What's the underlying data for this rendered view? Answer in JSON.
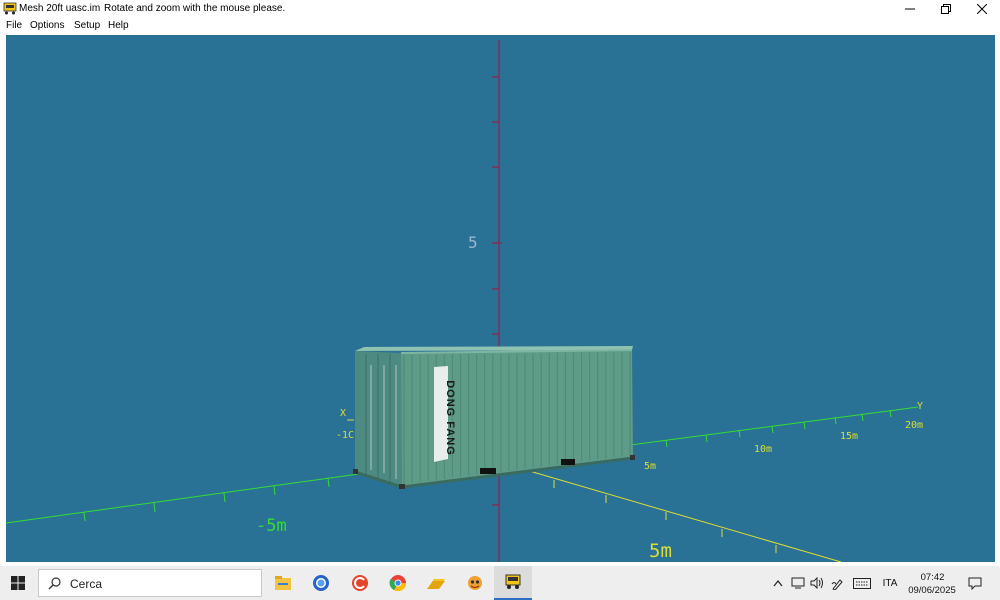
{
  "window": {
    "title": "Mesh 20ft uasc.im",
    "hint": "Rotate and zoom with the mouse please.",
    "minimize_icon": "minimize-icon",
    "restore_icon": "restore-icon",
    "close_icon": "close-icon"
  },
  "menu": {
    "items": [
      {
        "label": "File"
      },
      {
        "label": "Options"
      },
      {
        "label": "Setup"
      },
      {
        "label": "Help"
      }
    ]
  },
  "viewport": {
    "background": "#2a7295",
    "z_tick_label": "5",
    "x_axis_letter": "X",
    "x_tick_label": "-1C",
    "y_axis_letter": "Y",
    "y_ticks": [
      "5m",
      "10m",
      "15m",
      "20m"
    ],
    "neg_tick_label": "-5m",
    "near_tick_label": "5m",
    "container_text": "DONG FANG",
    "container_color": "#5e9c88",
    "axis_green": "#33dd33",
    "axis_yellow": "#dddd33",
    "axis_red": "#a0143c"
  },
  "taskbar": {
    "search_placeholder": "Cerca",
    "apps": [
      "file-explorer-icon",
      "firefox-icon",
      "ccleaner-icon",
      "chrome-icon",
      "folder-icon",
      "game-icon",
      "mesh-app-icon"
    ],
    "tray_icons": [
      "chevron-up-icon",
      "network-icon",
      "volume-icon",
      "pen-icon",
      "keyboard-icon"
    ],
    "language": "ITA",
    "time": "07:42",
    "date": "09/06/2025",
    "notifications_icon": "notifications-icon"
  }
}
